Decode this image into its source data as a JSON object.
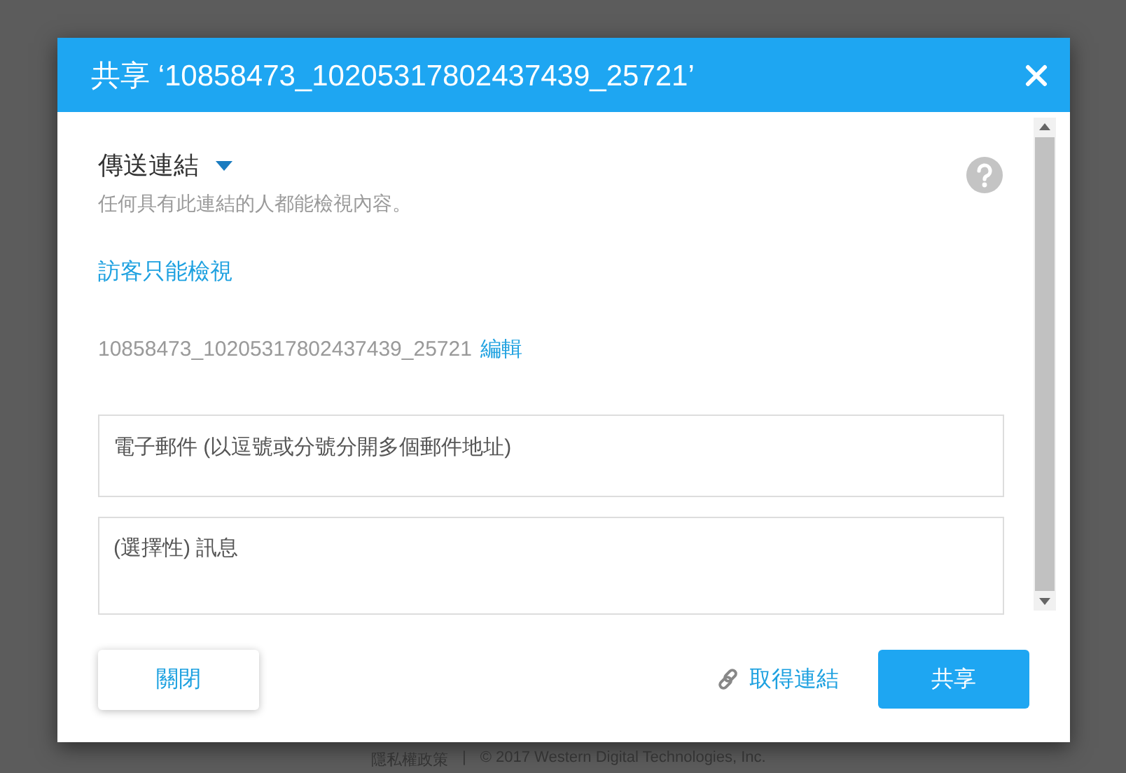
{
  "dialog": {
    "title": "共享 ‘10858473_10205317802437439_25721’"
  },
  "section": {
    "heading": "傳送連結",
    "description": "任何具有此連結的人都能檢視內容。"
  },
  "permission_link": "訪客只能檢視",
  "file": {
    "name": "10858473_10205317802437439_25721",
    "edit_link": "編輯"
  },
  "fields": [
    {
      "kind": "input",
      "placeholder": "電子郵件 (以逗號或分號分開多個郵件地址)"
    },
    {
      "kind": "textarea",
      "placeholder": "(選擇性) 訊息"
    }
  ],
  "buttons": {
    "close": "關閉",
    "get_link": "取得連結",
    "share": "共享"
  },
  "background_footer": {
    "privacy": "隱私權政策",
    "separator": "|",
    "copyright": "© 2017 Western Digital Technologies, Inc."
  }
}
